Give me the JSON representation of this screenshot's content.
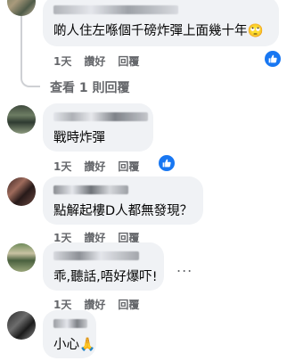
{
  "comments": [
    {
      "text": "啲人住左喺個千磅炸彈上面幾十年",
      "emoji": "🙄",
      "time": "1天",
      "like": "讚好",
      "reply": "回覆",
      "has_like_badge": true
    },
    {
      "text": "戰時炸彈",
      "time": "1天",
      "like": "讚好",
      "reply": "回覆",
      "has_like_badge": true
    },
    {
      "text": "點解起樓D人都無發現？",
      "time": "1天",
      "like": "讚好",
      "reply": "回覆",
      "has_like_badge": false
    },
    {
      "text": "乖,聽話,唔好爆吓!",
      "time": "1天",
      "like": "讚好",
      "reply": "回覆",
      "has_like_badge": false
    },
    {
      "text": "小心",
      "emoji": "🙏"
    }
  ],
  "view_replies": "查看 1 則回覆",
  "more_options": "...",
  "colors": {
    "like_blue": "#1877f2",
    "bubble_bg": "#f0f2f5",
    "meta_gray": "#65676b"
  },
  "icons": {
    "like_badge": "thumbs-up-icon",
    "more": "more-options-icon"
  }
}
